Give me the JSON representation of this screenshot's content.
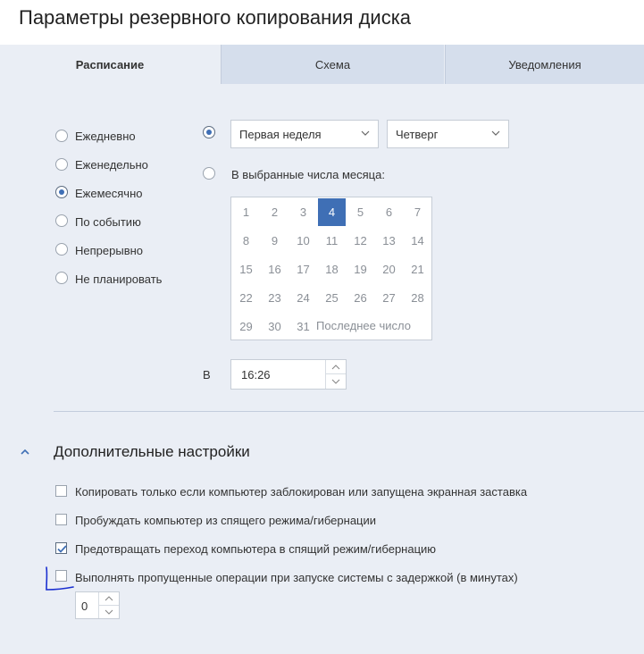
{
  "window": {
    "title": "Параметры резервного копирования диска"
  },
  "tabs": [
    {
      "label": "Расписание",
      "active": true
    },
    {
      "label": "Схема",
      "active": false
    },
    {
      "label": "Уведомления",
      "active": false
    }
  ],
  "frequency": {
    "options": [
      "Ежедневно",
      "Еженедельно",
      "Ежемесячно",
      "По событию",
      "Непрерывно",
      "Не планировать"
    ],
    "selected": "Ежемесячно"
  },
  "monthly": {
    "week_mode_selected": true,
    "week_select": "Первая неделя",
    "weekday_select": "Четверг",
    "dates_label": "В выбранные числа месяца:",
    "days": [
      "1",
      "2",
      "3",
      "4",
      "5",
      "6",
      "7",
      "8",
      "9",
      "10",
      "11",
      "12",
      "13",
      "14",
      "15",
      "16",
      "17",
      "18",
      "19",
      "20",
      "21",
      "22",
      "23",
      "24",
      "25",
      "26",
      "27",
      "28",
      "29",
      "30",
      "31"
    ],
    "selected_day": "4",
    "last_day_label": "Последнее число"
  },
  "time": {
    "label": "В",
    "value": "16:26"
  },
  "advanced": {
    "title": "Дополнительные настройки",
    "options": [
      {
        "label": "Копировать только если компьютер заблокирован или запущена экранная заставка",
        "checked": false
      },
      {
        "label": "Пробуждать компьютер из спящего режима/гибернации",
        "checked": false
      },
      {
        "label": "Предотвращать переход компьютера в спящий режим/гибернацию",
        "checked": true
      },
      {
        "label": "Выполнять пропущенные операции при запуске системы с задержкой (в минутах)",
        "checked": false
      }
    ],
    "delay_value": "0"
  },
  "colors": {
    "accent": "#3f6fb5",
    "background": "#eaeef5",
    "tab_inactive": "#d5deec",
    "annotation": "#1a2fd0"
  }
}
